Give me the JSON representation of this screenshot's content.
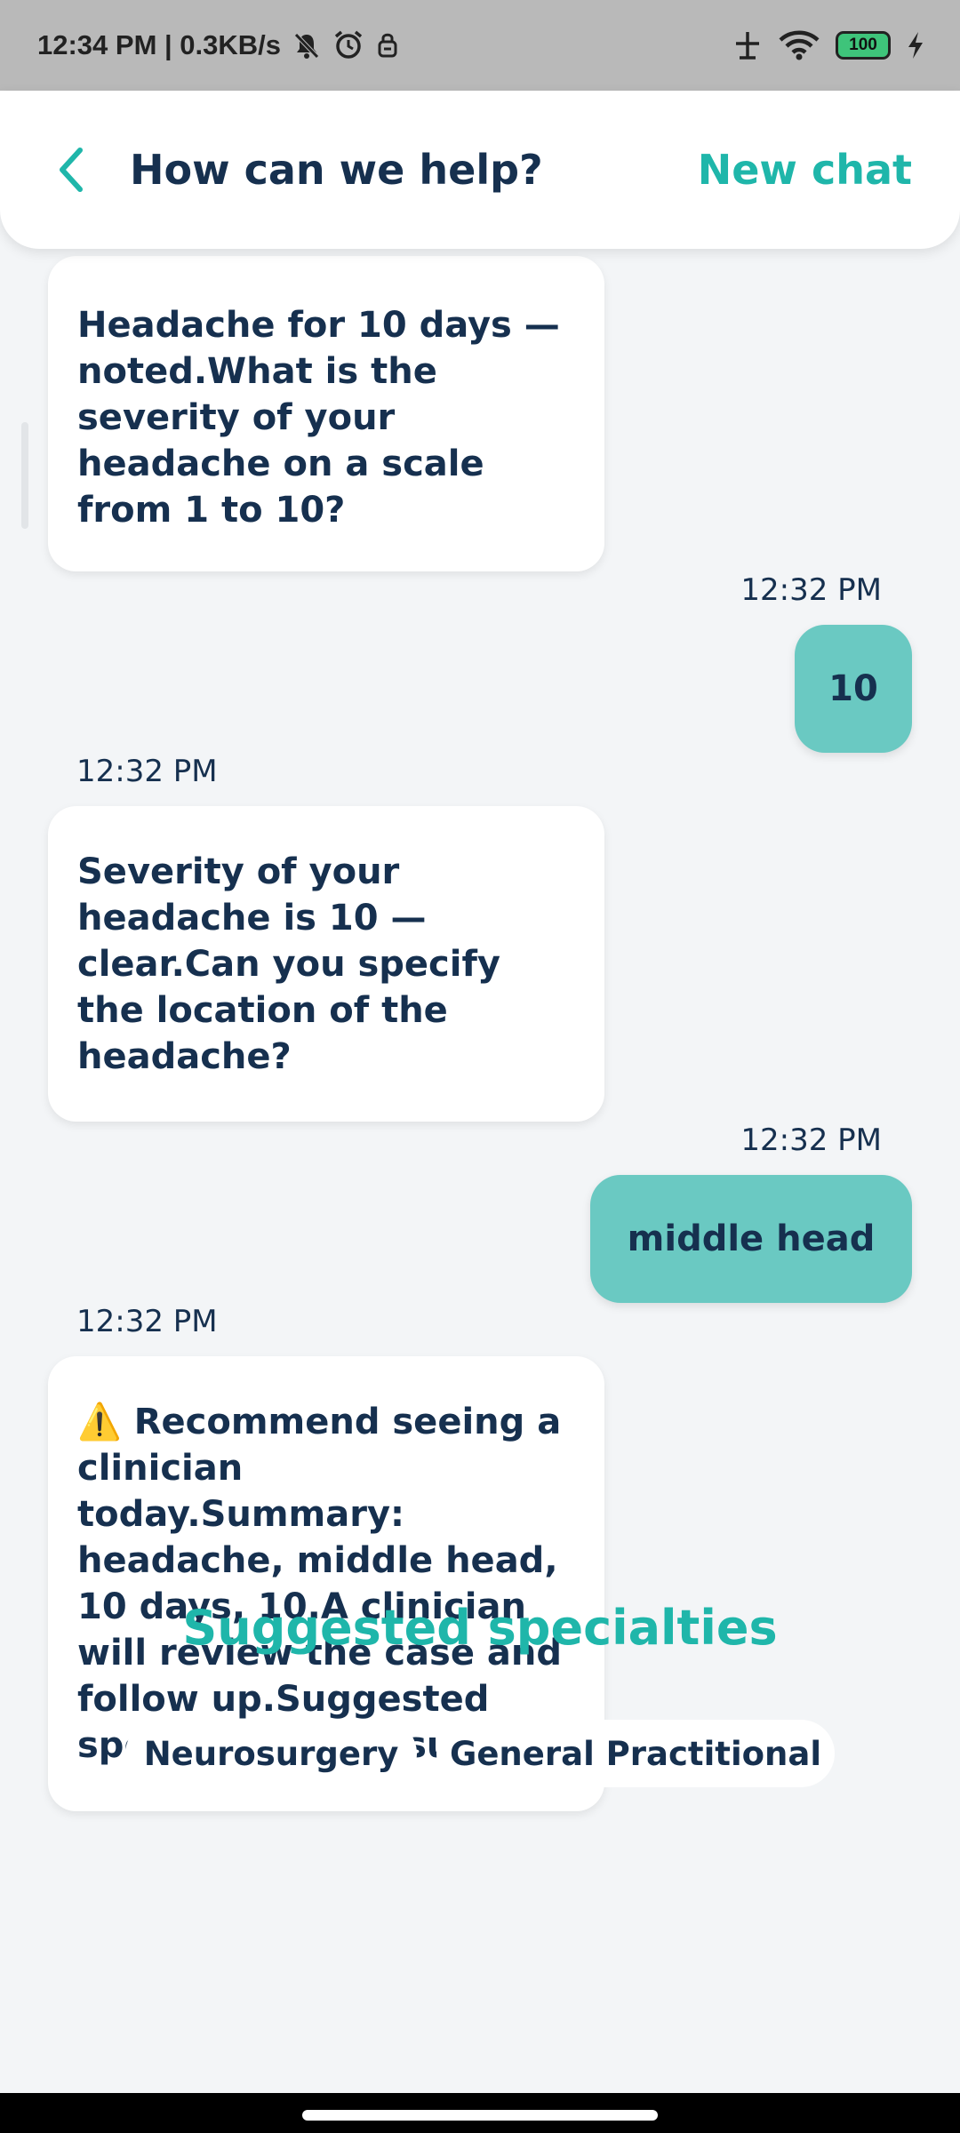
{
  "status_bar": {
    "time_speed": "12:34 PM | 0.3KB/s",
    "battery": "100",
    "icons": [
      "mute-icon",
      "alarm-icon",
      "lock-icon",
      "signal-icon",
      "wifi-icon",
      "battery-icon",
      "charging-icon"
    ]
  },
  "header": {
    "title": "How can we help?",
    "new_chat": "New chat",
    "back_icon": "chevron-left-icon"
  },
  "messages": [
    {
      "sender": "bot",
      "text": "Headache for 10 days — noted.What is the severity of your headache on a scale from 1 to 10?"
    },
    {
      "sender": "user",
      "time": "12:32 PM",
      "text": "10"
    },
    {
      "sender": "bot",
      "time": "12:32 PM",
      "text": "Severity of your headache is 10 — clear.Can you specify the location of the headache?"
    },
    {
      "sender": "user",
      "time": "12:32 PM",
      "text": "middle head"
    },
    {
      "sender": "bot",
      "time": "12:32 PM",
      "text": "⚠️ Recommend seeing a clinician today.Summary: headache, middle head, 10 days, 10.A clinician will review the case and follow up.Suggested specialty: Neurosurgery."
    }
  ],
  "suggested": {
    "title": "Suggested specialties",
    "chips": [
      "Neurosurgery",
      "General Practitional"
    ]
  },
  "colors": {
    "accent": "#1fb6aa",
    "user_bubble": "#6ac9c2",
    "text_dark": "#16304f",
    "background": "#f3f5f7"
  }
}
